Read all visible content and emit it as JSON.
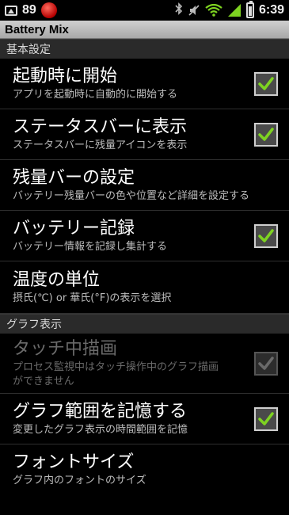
{
  "status_bar": {
    "battery_level": "89",
    "time": "6:39"
  },
  "title_bar": {
    "title": "Battery Mix"
  },
  "sections": [
    {
      "header": "基本設定",
      "items": [
        {
          "title": "起動時に開始",
          "summary": "アプリを起動時に自動的に開始する",
          "checked": true,
          "enabled": true
        },
        {
          "title": "ステータスバーに表示",
          "summary": "ステータスバーに残量アイコンを表示",
          "checked": true,
          "enabled": true
        },
        {
          "title": "残量バーの設定",
          "summary": "バッテリー残量バーの色や位置など詳細を設定する"
        },
        {
          "title": "バッテリー記録",
          "summary": "バッテリー情報を記録し集計する",
          "checked": true,
          "enabled": true
        },
        {
          "title": "温度の単位",
          "summary": "摂氏(℃) or 華氏(°F)の表示を選択"
        }
      ]
    },
    {
      "header": "グラフ表示",
      "items": [
        {
          "title": "タッチ中描画",
          "summary_line1": "プロセス監視中はタッチ操作中のグラフ描画",
          "summary_line2": "ができません",
          "checked": true,
          "enabled": false
        },
        {
          "title": "グラフ範囲を記憶する",
          "summary": "変更したグラフ表示の時間範囲を記憶",
          "checked": true,
          "enabled": true
        },
        {
          "title": "フォントサイズ",
          "summary": "グラフ内のフォントのサイズ"
        }
      ]
    }
  ],
  "colors": {
    "check_green": "#7ed321",
    "background": "#000000",
    "section_bg": "#2a2a2a"
  }
}
